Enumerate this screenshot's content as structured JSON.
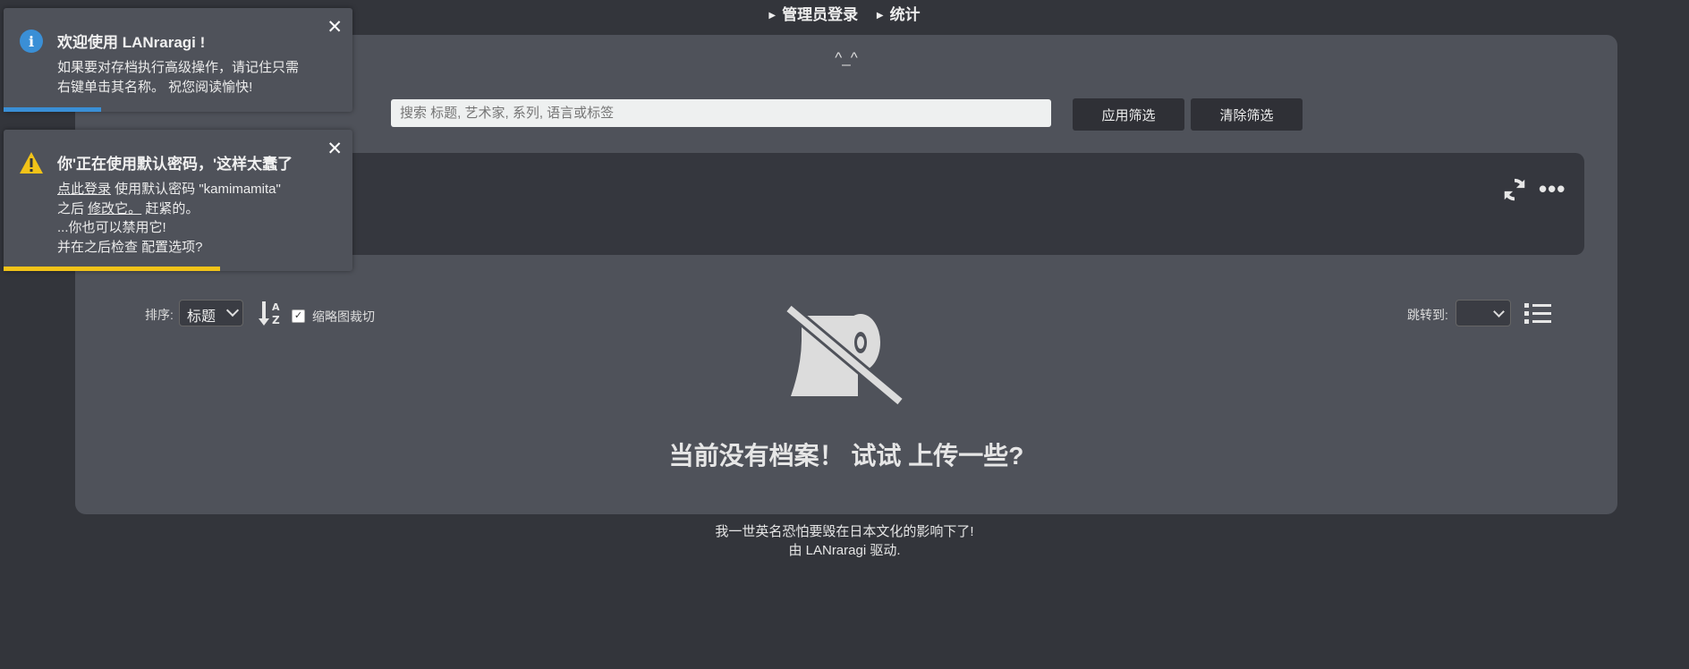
{
  "nav": {
    "admin_login": "管理员登录",
    "stats": "统计"
  },
  "main": {
    "motto": "^_^",
    "search_placeholder": "搜索 标题, 艺术家, 系列, 语言或标签",
    "apply_filter": "应用筛选",
    "clear_filter": "清除筛选",
    "sort_label": "排序:",
    "sort_value": "标题",
    "crop_label": "缩略图裁切",
    "crop_checked": true,
    "jump_label": "跳转到:",
    "empty_text": "当前没有档案！ 试试 上传一些?"
  },
  "footer": {
    "line1": "我一世英名恐怕要毁在日本文化的影响下了!",
    "line2": "由 LANraragi 驱动."
  },
  "toasts": [
    {
      "icon": "info-icon",
      "title": "欢迎使用 LANraragi !",
      "line1": "如果要对存档执行高级操作，请记住只需",
      "line2": "右键单击其名称。 祝您阅读愉快!",
      "progress": 0.28,
      "color": "#3a8fd6"
    },
    {
      "icon": "warning-icon",
      "title": "你'正在使用默认密码，'这样太蠢了",
      "line1_link": "点此登录",
      "line1_rest": " 使用默认密码 \"kamimamita\"",
      "line2_pre": "之后 ",
      "line2_link": "修改它。",
      "line2_rest": " 赶紧的。",
      "line3": "...你也可以禁用它!",
      "line4_pre": "并在之后检查 ",
      "line4_link": "配置选项?",
      "progress": 0.62,
      "color": "#f2c318"
    }
  ]
}
